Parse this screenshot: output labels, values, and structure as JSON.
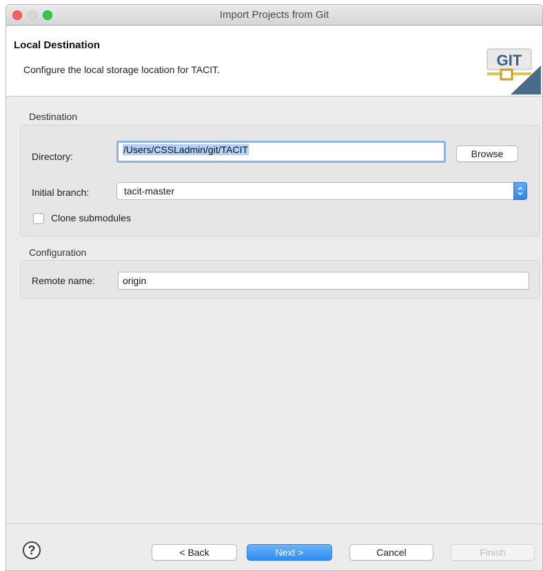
{
  "window": {
    "title": "Import Projects from Git"
  },
  "banner": {
    "title": "Local Destination",
    "description": "Configure the local storage location for TACIT.",
    "logo_text": "GIT"
  },
  "destination": {
    "group_title": "Destination",
    "directory_label": "Directory:",
    "directory_value": "/Users/CSSLadmin/git/TACIT",
    "browse_label": "Browse",
    "branch_label": "Initial branch:",
    "branch_value": "tacit-master",
    "clone_submodules_label": "Clone submodules",
    "clone_submodules_checked": false
  },
  "configuration": {
    "group_title": "Configuration",
    "remote_label": "Remote name:",
    "remote_value": "origin"
  },
  "footer": {
    "help_symbol": "?",
    "back_label": "< Back",
    "next_label": "Next >",
    "cancel_label": "Cancel",
    "finish_label": "Finish"
  },
  "colors": {
    "accent": "#2d8cf4",
    "selection": "#b4d2f8",
    "focus_ring": "#8fb2e6",
    "close": "#fc605c",
    "maximize": "#34c84a"
  }
}
